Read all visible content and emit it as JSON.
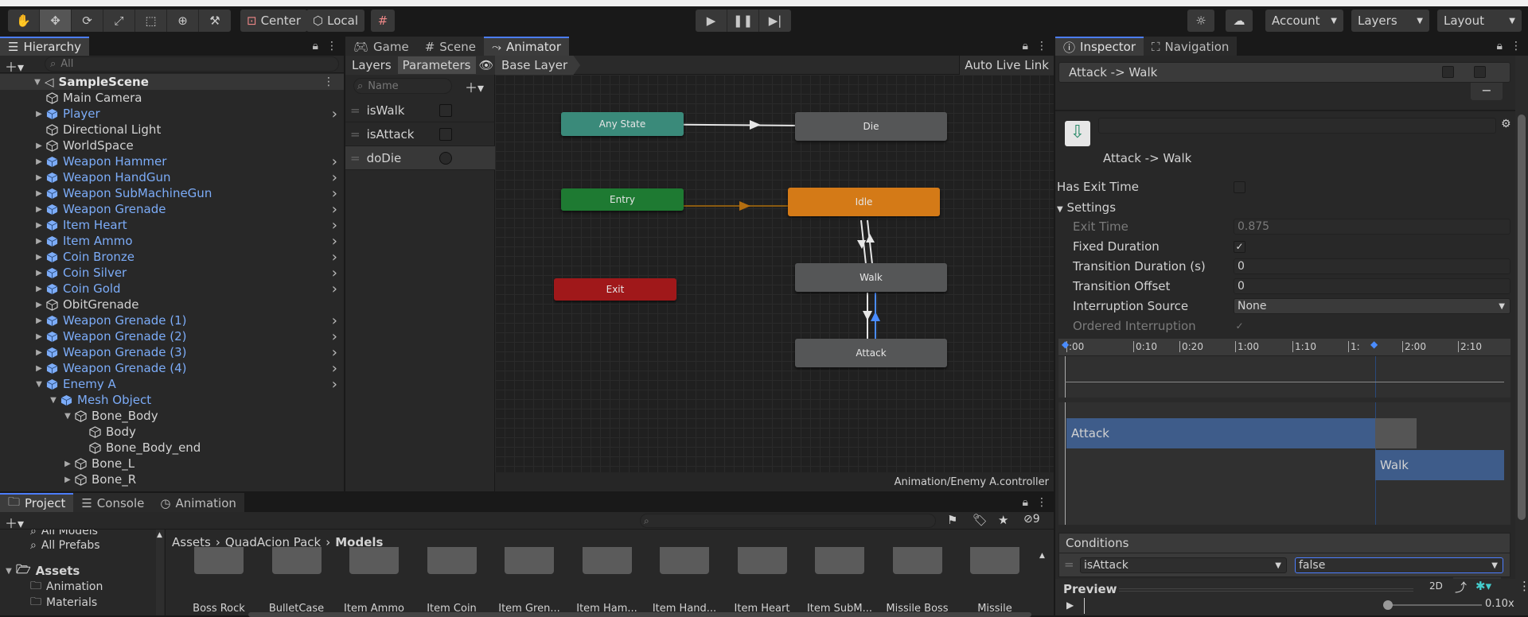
{
  "toolbar": {
    "center_label": "Center",
    "local_label": "Local",
    "account_label": "Account",
    "layers_label": "Layers",
    "layout_label": "Layout",
    "tools": [
      "hand-tool-icon",
      "move-tool-icon",
      "rotate-tool-icon",
      "scale-tool-icon",
      "rect-tool-icon",
      "transform-tool-icon",
      "custom-tool-icon"
    ]
  },
  "hierarchy": {
    "tab_label": "Hierarchy",
    "search_placeholder": "All",
    "scene": "SampleScene",
    "items": [
      {
        "label": "Main Camera",
        "indent": 1,
        "prefab": false,
        "fold": "",
        "arrow": false
      },
      {
        "label": "Player",
        "indent": 1,
        "prefab": true,
        "fold": "▶",
        "arrow": true
      },
      {
        "label": "Directional Light",
        "indent": 1,
        "prefab": false,
        "fold": "",
        "arrow": false
      },
      {
        "label": "WorldSpace",
        "indent": 1,
        "prefab": false,
        "fold": "▶",
        "arrow": false
      },
      {
        "label": "Weapon Hammer",
        "indent": 1,
        "prefab": true,
        "fold": "▶",
        "arrow": true
      },
      {
        "label": "Weapon HandGun",
        "indent": 1,
        "prefab": true,
        "fold": "▶",
        "arrow": true
      },
      {
        "label": "Weapon SubMachineGun",
        "indent": 1,
        "prefab": true,
        "fold": "▶",
        "arrow": true
      },
      {
        "label": "Weapon Grenade",
        "indent": 1,
        "prefab": true,
        "fold": "▶",
        "arrow": true
      },
      {
        "label": "Item Heart",
        "indent": 1,
        "prefab": true,
        "fold": "▶",
        "arrow": true
      },
      {
        "label": "Item Ammo",
        "indent": 1,
        "prefab": true,
        "fold": "▶",
        "arrow": true
      },
      {
        "label": "Coin Bronze",
        "indent": 1,
        "prefab": true,
        "fold": "▶",
        "arrow": true
      },
      {
        "label": "Coin Silver",
        "indent": 1,
        "prefab": true,
        "fold": "▶",
        "arrow": true
      },
      {
        "label": "Coin Gold",
        "indent": 1,
        "prefab": true,
        "fold": "▶",
        "arrow": true
      },
      {
        "label": "ObitGrenade",
        "indent": 1,
        "prefab": false,
        "fold": "▶",
        "arrow": false
      },
      {
        "label": "Weapon Grenade (1)",
        "indent": 1,
        "prefab": true,
        "fold": "▶",
        "arrow": true
      },
      {
        "label": "Weapon Grenade (2)",
        "indent": 1,
        "prefab": true,
        "fold": "▶",
        "arrow": true
      },
      {
        "label": "Weapon Grenade (3)",
        "indent": 1,
        "prefab": true,
        "fold": "▶",
        "arrow": true
      },
      {
        "label": "Weapon Grenade (4)",
        "indent": 1,
        "prefab": true,
        "fold": "▶",
        "arrow": true
      },
      {
        "label": "Enemy A",
        "indent": 1,
        "prefab": true,
        "fold": "▼",
        "arrow": true
      },
      {
        "label": "Mesh Object",
        "indent": 2,
        "prefab": true,
        "fold": "▼",
        "arrow": false
      },
      {
        "label": "Bone_Body",
        "indent": 3,
        "prefab": false,
        "fold": "▼",
        "arrow": false
      },
      {
        "label": "Body",
        "indent": 4,
        "prefab": false,
        "fold": "",
        "arrow": false
      },
      {
        "label": "Bone_Body_end",
        "indent": 4,
        "prefab": false,
        "fold": "",
        "arrow": false
      },
      {
        "label": "Bone_L",
        "indent": 3,
        "prefab": false,
        "fold": "▶",
        "arrow": false
      },
      {
        "label": "Bone_R",
        "indent": 3,
        "prefab": false,
        "fold": "▶",
        "arrow": false
      }
    ]
  },
  "center_tabs": {
    "game": "Game",
    "scene": "Scene",
    "animator": "Animator"
  },
  "animator": {
    "layers_tab": "Layers",
    "parameters_tab": "Parameters",
    "breadcrumb": "Base Layer",
    "auto_live_link": "Auto Live Link",
    "name_placeholder": "Name",
    "params": [
      {
        "name": "isWalk",
        "type": "bool"
      },
      {
        "name": "isAttack",
        "type": "bool"
      },
      {
        "name": "doDie",
        "type": "trigger"
      }
    ],
    "nodes": {
      "any_state": "Any State",
      "die": "Die",
      "entry": "Entry",
      "idle": "Idle",
      "exit": "Exit",
      "walk": "Walk",
      "attack": "Attack"
    },
    "footer_path": "Animation/Enemy A.controller"
  },
  "inspector": {
    "tab_label": "Inspector",
    "nav_tab_label": "Navigation",
    "header_title": "Attack -> Walk",
    "transition_name": "Attack -> Walk",
    "has_exit_time_label": "Has Exit Time",
    "settings_label": "Settings",
    "exit_time_label": "Exit Time",
    "exit_time_value": "0.875",
    "fixed_duration_label": "Fixed Duration",
    "transition_duration_label": "Transition Duration (s)",
    "transition_duration_value": "0",
    "transition_offset_label": "Transition Offset",
    "transition_offset_value": "0",
    "interruption_source_label": "Interruption Source",
    "interruption_source_value": "None",
    "ordered_interruption_label": "Ordered Interruption",
    "timeline_ticks": [
      ":00",
      "0:10",
      "0:20",
      "1:00",
      "1:10",
      "1:",
      "2:00",
      "2:10"
    ],
    "clip_from": "Attack",
    "clip_to": "Walk",
    "conditions_label": "Conditions",
    "condition_param": "isAttack",
    "condition_value": "false",
    "preview_label": "Preview",
    "preview_mode": "2D",
    "preview_speed": "0.10x"
  },
  "project": {
    "tabs": {
      "project": "Project",
      "console": "Console",
      "animation": "Animation"
    },
    "tree": {
      "all_models": "All Models",
      "all_prefabs": "All Prefabs",
      "assets": "Assets",
      "animation": "Animation",
      "materials": "Materials"
    },
    "breadcrumb": {
      "assets": "Assets",
      "pack": "QuadAcion Pack",
      "models": "Models"
    },
    "hidden_count": "9",
    "assets": [
      "Boss Rock",
      "BulletCase",
      "Item Ammo",
      "Item Coin",
      "Item Gren...",
      "Item Ham...",
      "Item Hand...",
      "Item Heart",
      "Item SubM...",
      "Missile Boss",
      "Missile"
    ]
  },
  "colors": {
    "accent": "#4c7dff",
    "idle": "#d47a17",
    "entry": "#1e7a32",
    "exit": "#a0181a",
    "any_state": "#3a8a7a",
    "prefab": "#7cacf8"
  }
}
